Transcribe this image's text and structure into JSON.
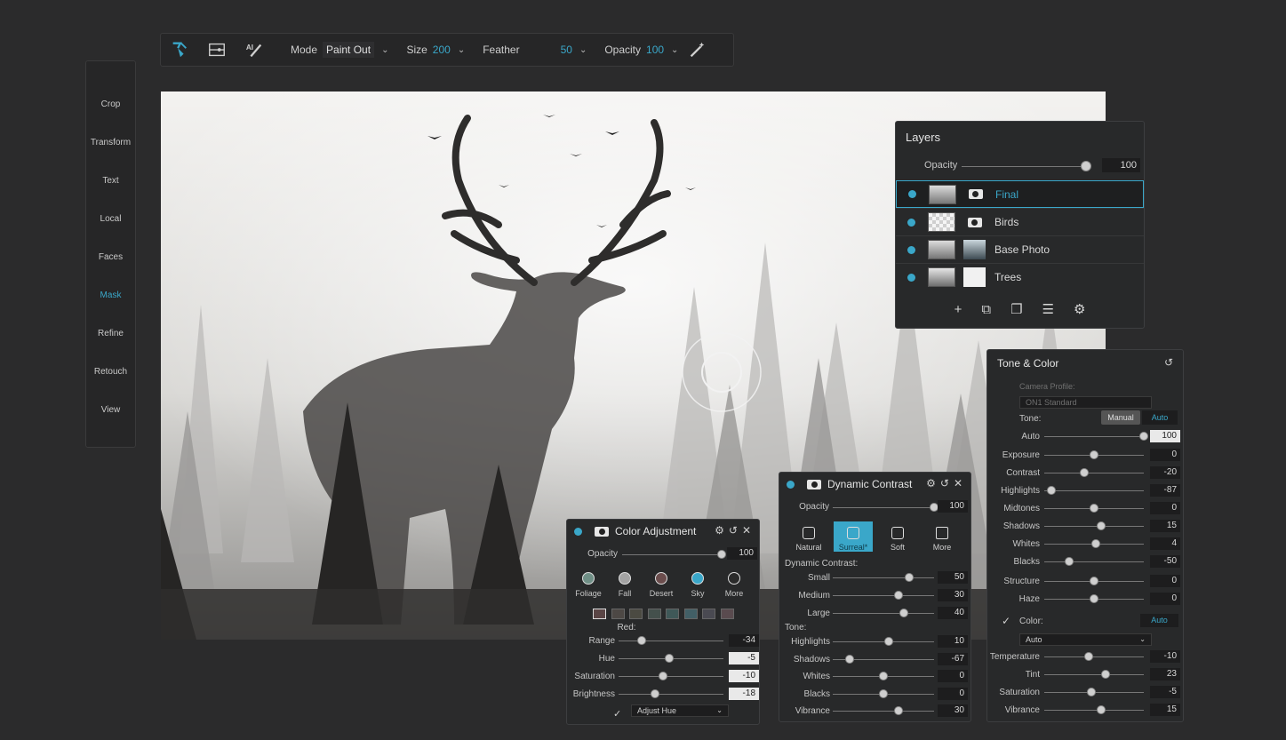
{
  "topbar": {
    "mode_label": "Mode",
    "mode_value": "Paint Out",
    "size_label": "Size",
    "size_value": "200",
    "feather_label": "Feather",
    "feather_value": "50",
    "opacity_label": "Opacity",
    "opacity_value": "100"
  },
  "tools": [
    {
      "label": "Crop",
      "icon": "crop-icon"
    },
    {
      "label": "Transform",
      "icon": "move-icon"
    },
    {
      "label": "Text",
      "icon": "text-icon"
    },
    {
      "label": "Local",
      "icon": "brush-icon"
    },
    {
      "label": "Faces",
      "icon": "face-brush-icon"
    },
    {
      "label": "Mask",
      "icon": "mask-brush-icon"
    },
    {
      "label": "Refine",
      "icon": "refine-brush-icon"
    },
    {
      "label": "Retouch",
      "icon": "eraser-icon"
    },
    {
      "label": "View",
      "icon": "zoom-hand-icon"
    }
  ],
  "layers": {
    "title": "Layers",
    "opacity_label": "Opacity",
    "opacity_value": "100",
    "opacity_level": 0.98,
    "items": [
      {
        "name": "Final",
        "selected": true
      },
      {
        "name": "Birds"
      },
      {
        "name": "Base Photo"
      },
      {
        "name": "Trees"
      }
    ]
  },
  "tone": {
    "title": "Tone & Color",
    "camera_profile_label": "Camera Profile:",
    "camera_profile_value": "ON1 Standard",
    "tone_label": "Tone:",
    "manual_label": "Manual",
    "auto_label": "Auto",
    "sliders1": [
      {
        "label": "Auto",
        "value": "100",
        "level": 1.0,
        "light": true
      }
    ],
    "sliders2": [
      {
        "label": "Exposure",
        "value": "0",
        "level": 0.5
      },
      {
        "label": "Contrast",
        "value": "-20",
        "level": 0.4
      },
      {
        "label": "Highlights",
        "value": "-87",
        "level": 0.07
      },
      {
        "label": "Midtones",
        "value": "0",
        "level": 0.5
      },
      {
        "label": "Shadows",
        "value": "15",
        "level": 0.57
      },
      {
        "label": "Whites",
        "value": "4",
        "level": 0.52
      },
      {
        "label": "Blacks",
        "value": "-50",
        "level": 0.25
      }
    ],
    "sliders3": [
      {
        "label": "Structure",
        "value": "0",
        "level": 0.5
      },
      {
        "label": "Haze",
        "value": "0",
        "level": 0.5
      }
    ],
    "color_label": "Color:",
    "color_auto": "Auto",
    "color_dropdown": "Auto",
    "sliders4": [
      {
        "label": "Temperature",
        "value": "-10",
        "level": 0.45
      },
      {
        "label": "Tint",
        "value": "23",
        "level": 0.62
      },
      {
        "label": "Saturation",
        "value": "-5",
        "level": 0.47
      },
      {
        "label": "Vibrance",
        "value": "15",
        "level": 0.57
      }
    ]
  },
  "dynamic": {
    "title": "Dynamic Contrast",
    "opacity_label": "Opacity",
    "opacity_value": "100",
    "opacity_level": 1.0,
    "presets": [
      {
        "label": "Natural"
      },
      {
        "label": "Surreal*",
        "active": true
      },
      {
        "label": "Soft"
      },
      {
        "label": "More"
      }
    ],
    "dc_label": "Dynamic Contrast:",
    "dc_sliders": [
      {
        "label": "Small",
        "value": "50",
        "level": 0.75
      },
      {
        "label": "Medium",
        "value": "30",
        "level": 0.65
      },
      {
        "label": "Large",
        "value": "40",
        "level": 0.7
      }
    ],
    "tone_label": "Tone:",
    "tone_sliders": [
      {
        "label": "Highlights",
        "value": "10",
        "level": 0.55
      },
      {
        "label": "Shadows",
        "value": "-67",
        "level": 0.17
      },
      {
        "label": "Whites",
        "value": "0",
        "level": 0.5
      },
      {
        "label": "Blacks",
        "value": "0",
        "level": 0.5
      },
      {
        "label": "Vibrance",
        "value": "30",
        "level": 0.65
      }
    ]
  },
  "coladj": {
    "title": "Color Adjustment",
    "opacity_label": "Opacity",
    "opacity_value": "100",
    "opacity_level": 1.0,
    "presets": [
      {
        "label": "Foliage",
        "color": "#6f8f86"
      },
      {
        "label": "Fall",
        "color": "#a3a3a3"
      },
      {
        "label": "Desert",
        "color": "#6b4d4d"
      },
      {
        "label": "Sky",
        "color": "#3aa7c9",
        "active": true
      },
      {
        "label": "More",
        "color": "#2a2a2a"
      }
    ],
    "swatches": [
      "#5a4545",
      "#4d4845",
      "#4b4a42",
      "#44504c",
      "#3f5858",
      "#425f66",
      "#4a4a52",
      "#5a4b4f"
    ],
    "swatch_label": "Red:",
    "sliders": [
      {
        "label": "Range",
        "value": "-34",
        "level": 0.22
      },
      {
        "label": "Hue",
        "value": "-5",
        "level": 0.48,
        "light": true
      },
      {
        "label": "Saturation",
        "value": "-10",
        "level": 0.42,
        "light": true
      },
      {
        "label": "Brightness",
        "value": "-18",
        "level": 0.35,
        "light": true
      }
    ],
    "adjust_dropdown": "Adjust Hue"
  }
}
